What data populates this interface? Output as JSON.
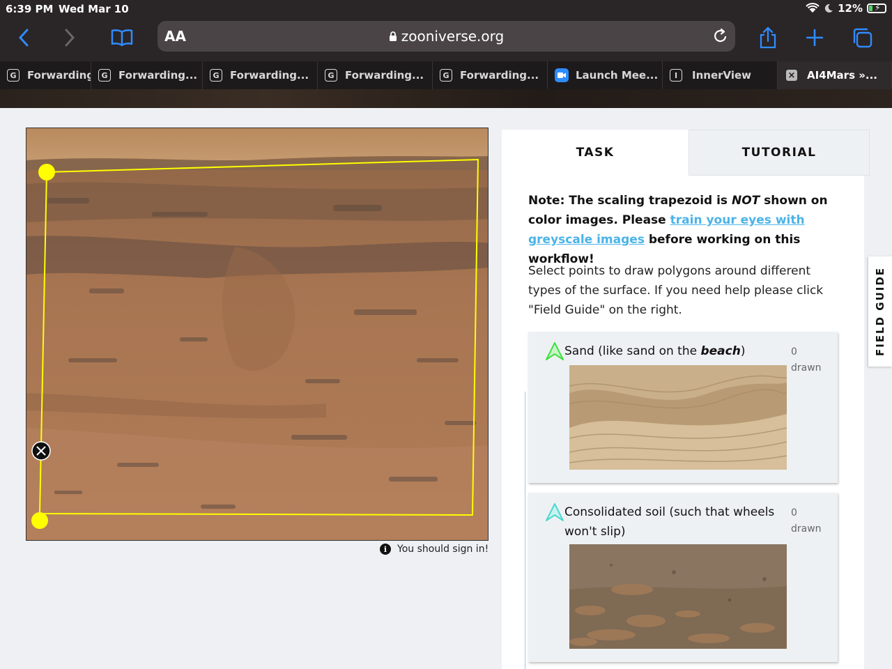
{
  "status_bar": {
    "time": "6:39 PM",
    "date": "Wed Mar 10",
    "battery": "12%"
  },
  "browser": {
    "text_size_label": "AA",
    "host": "zooniverse.org",
    "tabs": [
      {
        "title": "Forwarding",
        "icon": "google-favicon"
      },
      {
        "title": "Forwarding...",
        "icon": "google-favicon"
      },
      {
        "title": "Forwarding...",
        "icon": "google-favicon"
      },
      {
        "title": "Forwarding...",
        "icon": "google-favicon"
      },
      {
        "title": "Forwarding...",
        "icon": "google-favicon"
      },
      {
        "title": "Launch Mee...",
        "icon": "zoom-favicon"
      },
      {
        "title": "InnerView",
        "icon": "innerview-favicon"
      },
      {
        "title": "AI4Mars »...",
        "icon": "close-icon"
      }
    ]
  },
  "subject": {
    "sign_in_note": "You should sign in!"
  },
  "task_panel": {
    "tab_task": "TASK",
    "tab_tutorial": "TUTORIAL",
    "note": {
      "prefix": "Note: The scaling trapezoid is ",
      "emphasis": "NOT",
      "middle": " shown on color images. Please ",
      "link": "train your eyes with greyscale images",
      "suffix": " before working on this workflow!"
    },
    "instructions": "Select points to draw polygons around different types of the surface. If you need help please click \"Field Guide\" on the right.",
    "choices": [
      {
        "label_prefix": "Sand (like sand on the ",
        "label_emphasis": "beach",
        "label_suffix": ")",
        "count": "0",
        "count_unit": "drawn",
        "color": "#3ee03e"
      },
      {
        "label_prefix": "Consolidated soil (such that wheels won't slip)",
        "label_emphasis": "",
        "label_suffix": "",
        "count": "0",
        "count_unit": "drawn",
        "color": "#4fd8d0"
      }
    ]
  },
  "field_guide_label": "FIELD GUIDE",
  "colors": {
    "safari_blue": "#2f8cff",
    "polygon_yellow": "#ffff00",
    "link_blue": "#4bb3e8"
  }
}
